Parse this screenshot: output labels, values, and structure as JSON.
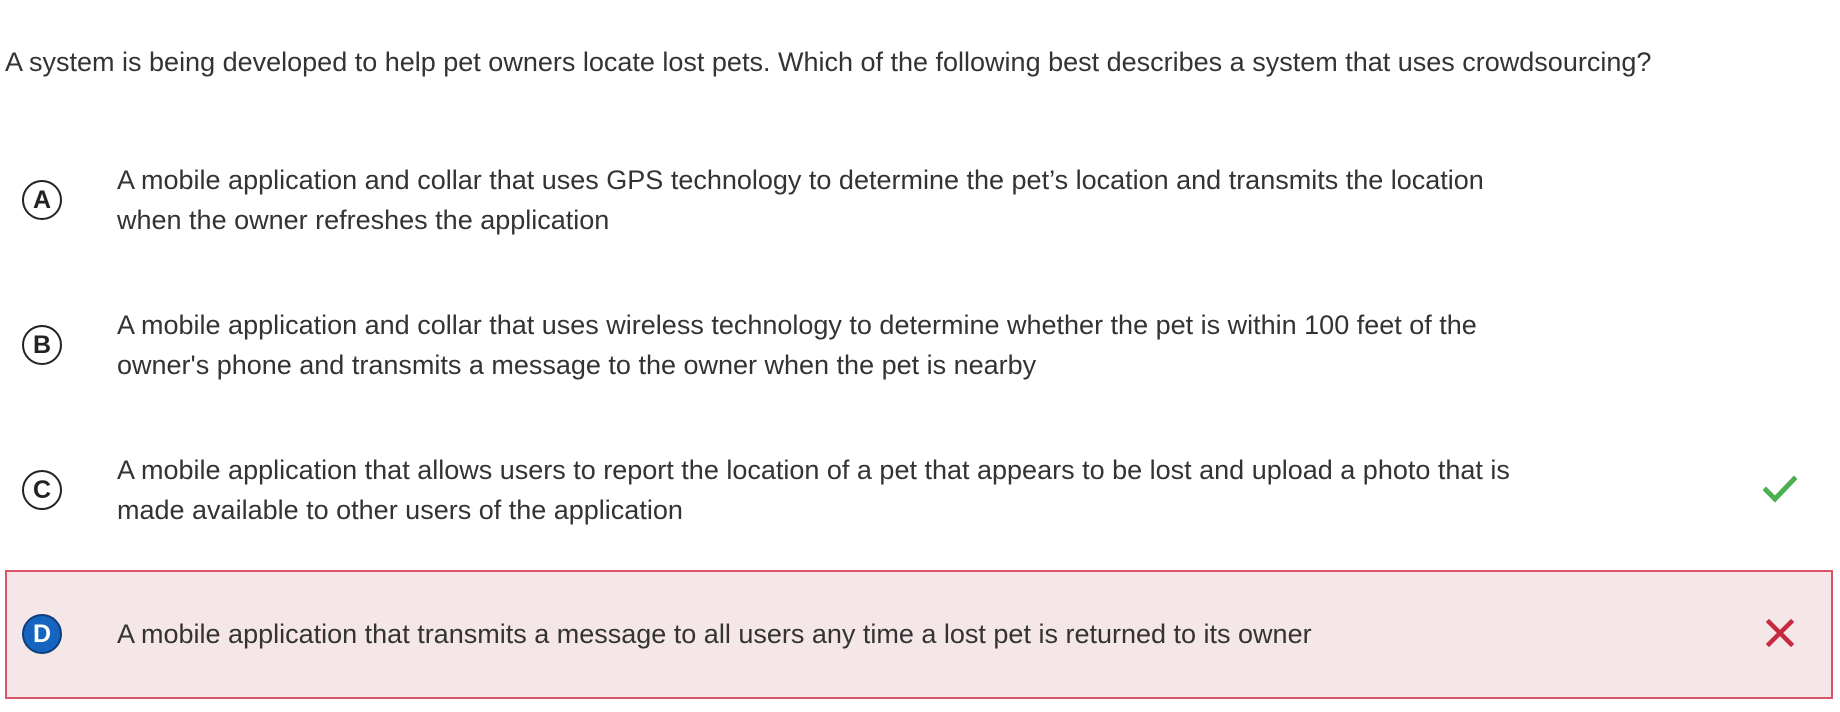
{
  "question": {
    "text": "A system is being developed to help pet owners locate lost pets. Which of the following best describes a system that uses crowdsourcing?"
  },
  "options": [
    {
      "letter": "A",
      "text": "A mobile application and collar that uses GPS technology to determine the pet’s location and transmits the location when the owner refreshes the application"
    },
    {
      "letter": "B",
      "text": "A mobile application and collar that uses wireless technology to determine whether the pet is within 100 feet of the owner's phone and transmits a message to the owner when the pet is nearby"
    },
    {
      "letter": "C",
      "text": "A mobile application that allows users to report the location of a pet that appears to be lost and upload a photo that is made available to other users of the application",
      "status": "correct",
      "status_icon": "check-icon"
    },
    {
      "letter": "D",
      "text": "A mobile application that transmits a message to all users any time a lost pet is returned to its owner",
      "status": "incorrect-selected",
      "status_icon": "cross-icon"
    }
  ],
  "colors": {
    "correct": "#4caf50",
    "incorrect": "#c62840",
    "selected_fill": "#1565c0",
    "incorrect_bg": "#f5e6e8",
    "incorrect_border": "#d9536a"
  }
}
